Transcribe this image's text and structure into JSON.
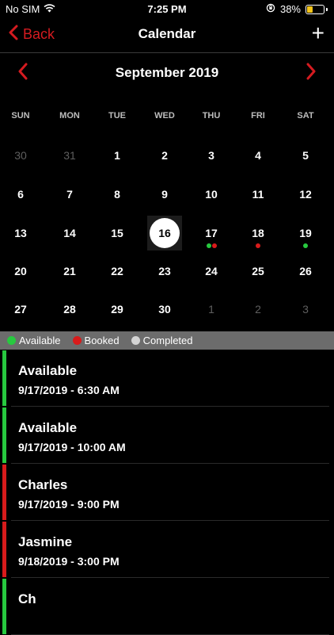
{
  "status": {
    "carrier": "No SIM",
    "time": "7:25 PM",
    "battery": "38%",
    "battery_level": 0.38
  },
  "nav": {
    "back_label": "Back",
    "title": "Calendar",
    "add_label": "+"
  },
  "calendar": {
    "month_title": "September 2019",
    "weekdays": [
      "SUN",
      "MON",
      "TUE",
      "WED",
      "THU",
      "FRI",
      "SAT"
    ],
    "weeks": [
      [
        {
          "d": "30",
          "muted": true
        },
        {
          "d": "31",
          "muted": true
        },
        {
          "d": "1"
        },
        {
          "d": "2"
        },
        {
          "d": "3"
        },
        {
          "d": "4"
        },
        {
          "d": "5"
        }
      ],
      [
        {
          "d": "6"
        },
        {
          "d": "7"
        },
        {
          "d": "8"
        },
        {
          "d": "9"
        },
        {
          "d": "10"
        },
        {
          "d": "11"
        },
        {
          "d": "12"
        }
      ],
      [
        {
          "d": "13"
        },
        {
          "d": "14"
        },
        {
          "d": "15"
        },
        {
          "d": "16",
          "selected": true
        },
        {
          "d": "17",
          "dots": [
            "green",
            "red"
          ]
        },
        {
          "d": "18",
          "dots": [
            "red"
          ]
        },
        {
          "d": "19",
          "dots": [
            "green"
          ]
        }
      ],
      [
        {
          "d": "20"
        },
        {
          "d": "21"
        },
        {
          "d": "22"
        },
        {
          "d": "23"
        },
        {
          "d": "24"
        },
        {
          "d": "25"
        },
        {
          "d": "26"
        }
      ],
      [
        {
          "d": "27"
        },
        {
          "d": "28"
        },
        {
          "d": "29"
        },
        {
          "d": "30"
        },
        {
          "d": "1",
          "muted": true
        },
        {
          "d": "2",
          "muted": true
        },
        {
          "d": "3",
          "muted": true
        }
      ]
    ]
  },
  "legend": [
    {
      "label": "Available",
      "color": "#27c93f"
    },
    {
      "label": "Booked",
      "color": "#d81b1b"
    },
    {
      "label": "Completed",
      "color": "#d4d4d4"
    }
  ],
  "events": [
    {
      "title": "Available",
      "date": "9/17/2019 - 6:30 AM",
      "color": "#27c93f"
    },
    {
      "title": "Available",
      "date": "9/17/2019 - 10:00 AM",
      "color": "#27c93f"
    },
    {
      "title": "Charles",
      "date": "9/17/2019 - 9:00 PM",
      "color": "#d81b1b"
    },
    {
      "title": "Jasmine",
      "date": "9/18/2019 - 3:00 PM",
      "color": "#d81b1b"
    },
    {
      "title": "Ch",
      "date": "",
      "color": "#27c93f"
    }
  ],
  "colors": {
    "accent": "#d51b20",
    "green": "#27c93f",
    "red": "#d81b1b"
  }
}
